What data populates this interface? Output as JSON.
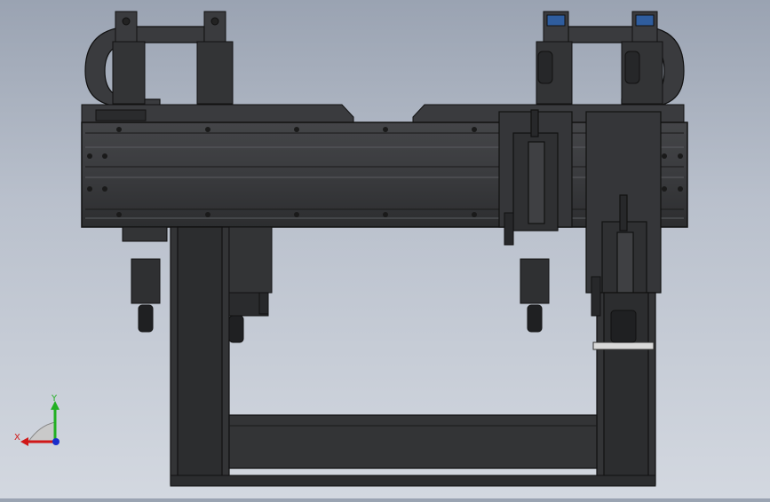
{
  "viewport": {
    "colors": {
      "background_top": "#9aa3b2",
      "background_bottom": "#d3d8e0",
      "body_dark": "#2e2f31",
      "body_mid": "#3c3d40",
      "edge": "#151515",
      "highlight": "#5a5c60",
      "display_screen": "#2f5d9e",
      "white_plate": "#d9d9d9"
    }
  },
  "triad": {
    "x_label": "X",
    "y_label": "Y",
    "x_color": "#d01818",
    "y_color": "#22b022",
    "z_color": "#1a2ecc"
  }
}
